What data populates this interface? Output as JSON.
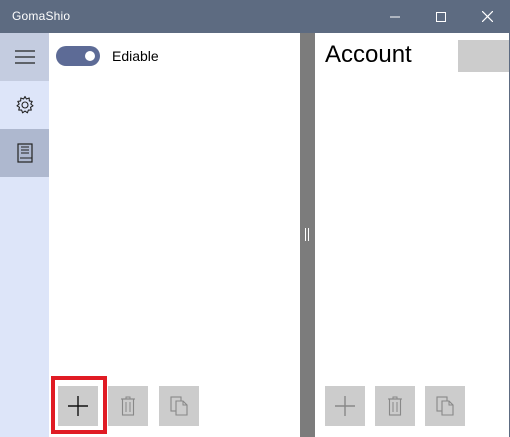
{
  "window": {
    "title": "GomaShio",
    "controls": [
      "minimize-icon",
      "maximize-icon",
      "close-icon"
    ]
  },
  "nav": {
    "items": [
      {
        "icon": "hamburger-menu-icon"
      },
      {
        "icon": "gear-icon"
      },
      {
        "icon": "book-icon"
      }
    ]
  },
  "left_pane": {
    "toggle": {
      "label": "Ediable",
      "on": true
    },
    "actions": [
      {
        "icon": "plus-icon",
        "highlighted": true
      },
      {
        "icon": "trash-icon"
      },
      {
        "icon": "copy-icon"
      }
    ]
  },
  "right_pane": {
    "title": "Account",
    "actions": [
      {
        "icon": "plus-icon"
      },
      {
        "icon": "trash-icon"
      },
      {
        "icon": "copy-icon"
      }
    ]
  },
  "colors": {
    "titlebar": "#5d6b81",
    "nav_background": "#dde5f9",
    "highlight": "#e01b24",
    "toggle_on": "#5d6b96"
  }
}
